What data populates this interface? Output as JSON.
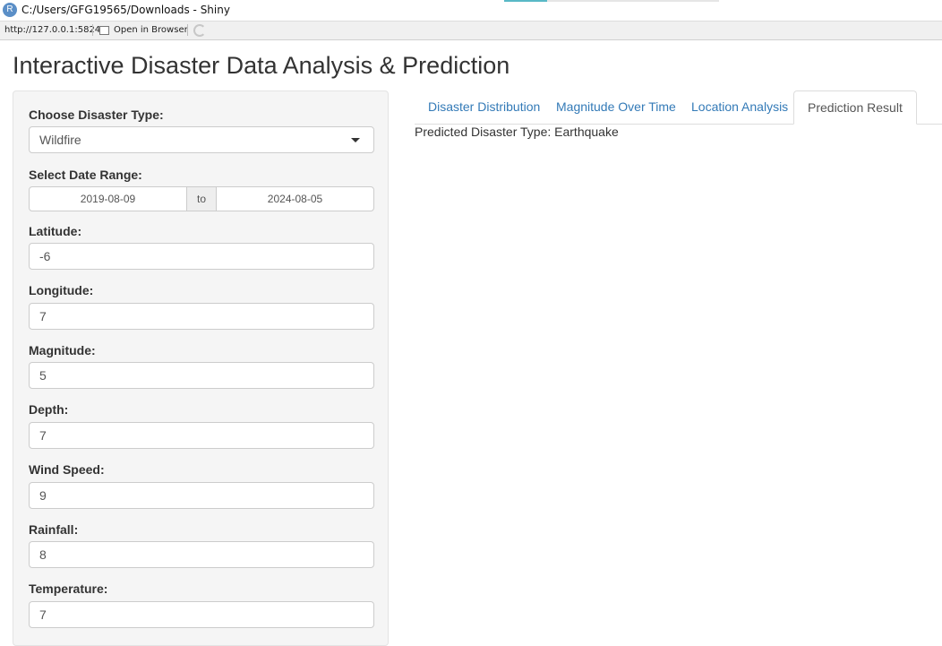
{
  "window": {
    "title": "C:/Users/GFG19565/Downloads - Shiny",
    "logo_letter": "R",
    "url": "http://127.0.0.1:5824",
    "open_in_browser": "Open in Browser"
  },
  "app": {
    "title": "Interactive Disaster Data Analysis & Prediction"
  },
  "sidebar": {
    "disaster_type_label": "Choose Disaster Type:",
    "disaster_type_value": "Wildfire",
    "date_range_label": "Select Date Range:",
    "date_start": "2019-08-09",
    "date_sep": "to",
    "date_end": "2024-08-05",
    "latitude_label": "Latitude:",
    "latitude_value": "-6",
    "longitude_label": "Longitude:",
    "longitude_value": "7",
    "magnitude_label": "Magnitude:",
    "magnitude_value": "5",
    "depth_label": "Depth:",
    "depth_value": "7",
    "wind_speed_label": "Wind Speed:",
    "wind_speed_value": "9",
    "rainfall_label": "Rainfall:",
    "rainfall_value": "8",
    "temperature_label": "Temperature:",
    "temperature_value": "7"
  },
  "tabs": [
    {
      "label": "Disaster Distribution",
      "active": false
    },
    {
      "label": "Magnitude Over Time",
      "active": false
    },
    {
      "label": "Location Analysis",
      "active": false
    },
    {
      "label": "Prediction Result",
      "active": true
    }
  ],
  "main": {
    "prediction_text": "Predicted Disaster Type: Earthquake"
  },
  "colors": {
    "link": "#337ab7",
    "sidebar_bg": "#f5f5f5",
    "border": "#cccccc"
  }
}
